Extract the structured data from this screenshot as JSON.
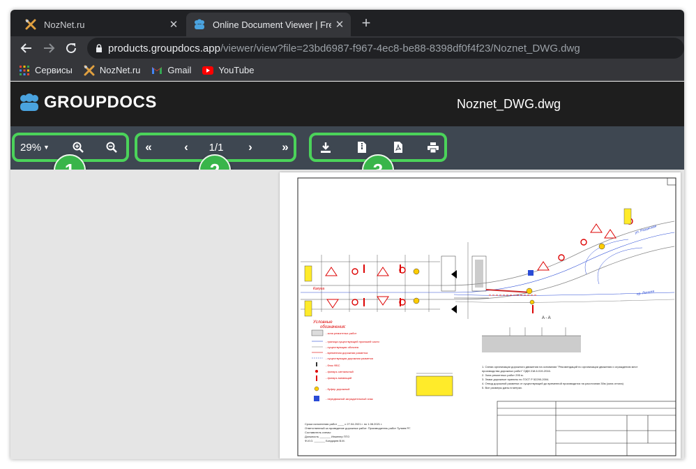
{
  "browser": {
    "tabs": [
      {
        "title": "NozNet.ru",
        "active": false,
        "icon": "noznet-icon"
      },
      {
        "title": "Online Document Viewer | Free G",
        "active": true,
        "icon": "groupdocs-icon"
      }
    ],
    "url_host": "products.groupdocs.app",
    "url_path": "/viewer/view?file=23bd6987-f967-4ec8-be88-8398df0f4f23/Noznet_DWG.dwg",
    "bookmarks": [
      {
        "label": "Сервисы",
        "icon": "apps-grid-icon"
      },
      {
        "label": "NozNet.ru",
        "icon": "noznet-icon"
      },
      {
        "label": "Gmail",
        "icon": "gmail-icon"
      },
      {
        "label": "YouTube",
        "icon": "youtube-icon"
      }
    ]
  },
  "app": {
    "logo_text": "GROUPDOCS",
    "document_name": "Noznet_DWG.dwg"
  },
  "toolbar": {
    "zoom_value": "29%",
    "page_indicator": "1/1",
    "highlight_color": "#4bd35a",
    "badges": [
      "1",
      "2",
      "3"
    ]
  },
  "drawing": {
    "section_label": "A - A",
    "street_1": "Калуга",
    "street_2": "пр. Ленина",
    "street_3": "ул. Рязанская"
  }
}
